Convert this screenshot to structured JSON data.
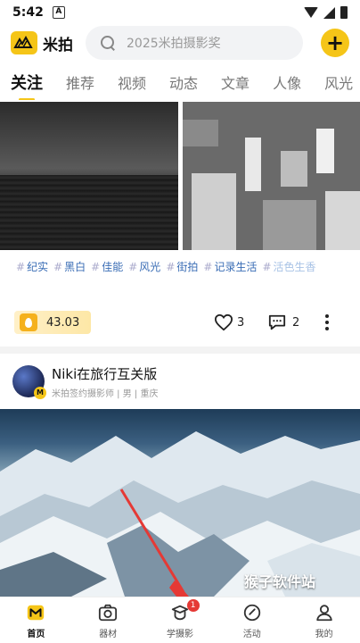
{
  "status_bar": {
    "time": "5:42",
    "notification_icon": "A"
  },
  "header": {
    "logo_text": "米拍",
    "search_placeholder": "2025米拍摄影奖",
    "add_button_icon": "plus-icon",
    "accent_color": "#f5c518"
  },
  "tabs": [
    {
      "label": "关注",
      "active": true
    },
    {
      "label": "推荐"
    },
    {
      "label": "视频"
    },
    {
      "label": "动态"
    },
    {
      "label": "文章"
    },
    {
      "label": "人像"
    },
    {
      "label": "风光"
    }
  ],
  "post1": {
    "tags": [
      "纪实",
      "黑白",
      "佳能",
      "风光",
      "街拍",
      "记录生活",
      "活色生香"
    ],
    "energy_value": "43.03",
    "like_count": "3",
    "comment_count": "2"
  },
  "post2": {
    "author_name": "Niki在旅行互关版",
    "author_meta": "米拍签约摄影师 | 男 | 重庆",
    "watermark": "猴子软件站"
  },
  "bottom_nav": [
    {
      "label": "首页",
      "icon": "home-icon",
      "active": true
    },
    {
      "label": "器材",
      "icon": "camera-icon"
    },
    {
      "label": "学摄影",
      "icon": "learn-icon",
      "badge": "1"
    },
    {
      "label": "活动",
      "icon": "activity-icon"
    },
    {
      "label": "我的",
      "icon": "profile-icon"
    }
  ]
}
